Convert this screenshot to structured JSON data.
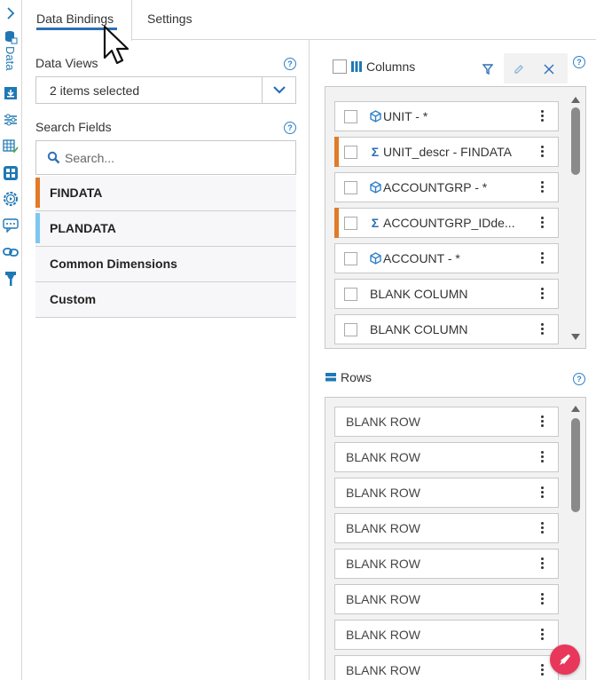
{
  "rail": {
    "vertical_label": "Data",
    "icons": [
      "chevron-right-icon",
      "database-icon",
      "download-box-icon",
      "sliders-icon",
      "table-check-icon",
      "widget-grid-icon",
      "gear-play-icon",
      "comment-icon",
      "link-icon",
      "funnel-icon"
    ]
  },
  "tabs": [
    {
      "label": "Data Bindings",
      "active": true
    },
    {
      "label": "Settings",
      "active": false
    }
  ],
  "left": {
    "data_views_label": "Data Views",
    "data_views_value": "2 items selected",
    "search_fields_label": "Search Fields",
    "search_placeholder": "Search...",
    "sources": [
      {
        "label": "FINDATA",
        "color": "#e07b27"
      },
      {
        "label": "PLANDATA",
        "color": "#7cc7f2"
      },
      {
        "label": "Common Dimensions",
        "color": ""
      },
      {
        "label": "Custom",
        "color": ""
      }
    ]
  },
  "columns": {
    "label": "Columns",
    "items": [
      {
        "label": "UNIT - *",
        "icon": "cube-icon",
        "mark": false
      },
      {
        "label": "UNIT_descr - FINDATA",
        "icon": "sigma-icon",
        "mark": true
      },
      {
        "label": "ACCOUNTGRP - *",
        "icon": "cube-icon",
        "mark": false
      },
      {
        "label": "ACCOUNTGRP_IDde...",
        "icon": "sigma-icon",
        "mark": true
      },
      {
        "label": "ACCOUNT - *",
        "icon": "cube-icon",
        "mark": false
      },
      {
        "label": "BLANK COLUMN",
        "icon": "",
        "mark": false
      },
      {
        "label": "BLANK COLUMN",
        "icon": "",
        "mark": false
      }
    ]
  },
  "rows": {
    "label": "Rows",
    "items": [
      "BLANK ROW",
      "BLANK ROW",
      "BLANK ROW",
      "BLANK ROW",
      "BLANK ROW",
      "BLANK ROW",
      "BLANK ROW",
      "BLANK ROW"
    ]
  },
  "colors": {
    "accent": "#2c6fb7",
    "findata": "#e07b27",
    "plandata": "#7cc7f2",
    "fab": "#e8375a"
  }
}
